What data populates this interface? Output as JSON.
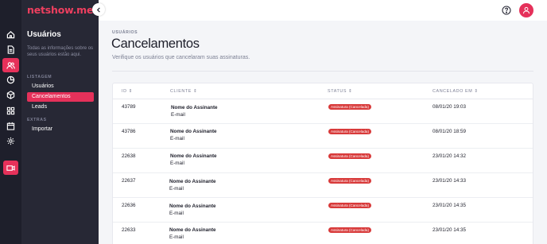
{
  "brand": {
    "name": "netshow.me"
  },
  "rail": [
    {
      "icon": "home-icon"
    },
    {
      "icon": "document-icon"
    },
    {
      "icon": "users-icon",
      "active": true
    },
    {
      "icon": "pie-chart-icon"
    },
    {
      "icon": "cube-icon"
    },
    {
      "icon": "grid-icon"
    },
    {
      "icon": "calendar-icon"
    },
    {
      "icon": "gear-icon"
    },
    {
      "icon": "live-camera-icon"
    }
  ],
  "sidebar": {
    "title": "Usuários",
    "description": "Todas as informações sobre os seus usuários estão aqui.",
    "sections": [
      {
        "label": "LISTAGEM",
        "items": [
          "Usuários",
          "Cancelamentos",
          "Leads"
        ]
      },
      {
        "label": "EXTRAS",
        "items": [
          "Importar"
        ]
      }
    ],
    "active_item": "Cancelamentos"
  },
  "header": {
    "help_icon": "help-icon",
    "avatar_icon": "user-icon"
  },
  "page": {
    "breadcrumb": "USUÁRIOS",
    "title": "Cancelamentos",
    "subtitle": "Verifique os usuários que cancelaram suas assinaturas."
  },
  "table": {
    "columns": [
      "ID ⇕",
      "CLIENTE ⇕",
      "STATUS ⇕",
      "CANCELADO EM ⇕"
    ],
    "rows": [
      {
        "id": "43789",
        "name": "Nome do Assinante",
        "email": "E-mail",
        "status": "Assinatura (Cancelada)",
        "date": "08/01/20 19:03"
      },
      {
        "id": "43786",
        "name": "Nome do Assinante",
        "email": "E-mail",
        "status": "Assinatura (Cancelada)",
        "date": "08/01/20 18:59"
      },
      {
        "id": "22638",
        "name": "Nome do Assinante",
        "email": "E-mail",
        "status": "Assinatura (Cancelada)",
        "date": "23/01/20 14:32"
      },
      {
        "id": "22637",
        "name": "Nome do Assinante",
        "email": "E-mail",
        "status": "Assinatura (Cancelada)",
        "date": "23/01/20 14:33"
      },
      {
        "id": "22636",
        "name": "Nome do Assinante",
        "email": "E-mail",
        "status": "Assinatura (Cancelada)",
        "date": "23/01/20 14:35"
      },
      {
        "id": "22633",
        "name": "Nome do Assinante",
        "email": "E-mail",
        "status": "Assinatura (Cancelada)",
        "date": "23/01/20 14:35"
      }
    ]
  },
  "colors": {
    "accent": "#e5315a",
    "rail": "#1e1f2b",
    "sidebar": "#272835",
    "badge": "#d83a3a"
  }
}
